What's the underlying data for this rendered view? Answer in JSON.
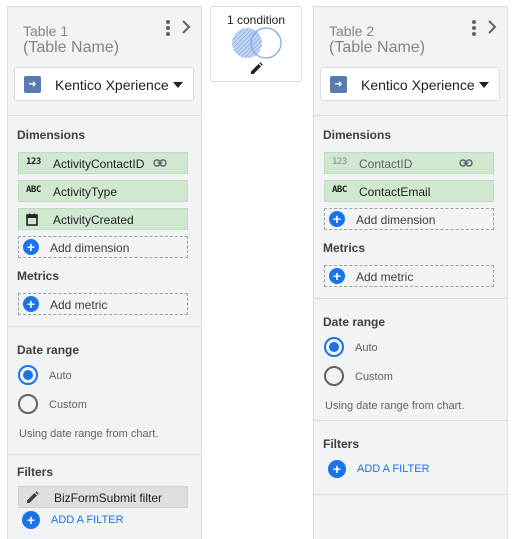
{
  "left_table": {
    "title": "Table 1",
    "subtitle": "(Table Name)",
    "source": "Kentico Xperience",
    "dimensions_label": "Dimensions",
    "dimensions": [
      {
        "type": "123",
        "name": "ActivityContactID",
        "icon": "link-icon"
      },
      {
        "type": "ABC",
        "name": "ActivityType"
      },
      {
        "type": "calendar",
        "name": "ActivityCreated"
      }
    ],
    "add_dimension": "Add dimension",
    "metrics_label": "Metrics",
    "add_metric": "Add metric",
    "date_range_label": "Date range",
    "date_options": [
      "Auto",
      "Custom"
    ],
    "date_selected": "Auto",
    "date_note": "Using date range from chart.",
    "filters_label": "Filters",
    "filter_chip": "BizFormSubmit filter",
    "add_filter": "ADD A FILTER"
  },
  "join": {
    "label": "1 condition"
  },
  "right_table": {
    "title": "Table 2",
    "subtitle": "(Table Name)",
    "source": "Kentico Xperience",
    "dimensions_label": "Dimensions",
    "dimensions": [
      {
        "type": "123",
        "name": "ContactID",
        "icon": "link-icon"
      },
      {
        "type": "ABC",
        "name": "ContactEmail"
      }
    ],
    "add_dimension": "Add dimension",
    "metrics_label": "Metrics",
    "add_metric": "Add metric",
    "date_range_label": "Date range",
    "date_options": [
      "Auto",
      "Custom"
    ],
    "date_selected": "Auto",
    "date_note": "Using date range from chart.",
    "filters_label": "Filters",
    "add_filter": "ADD A FILTER"
  },
  "colors": {
    "accent": "#1a73e8",
    "chip_green": "#cfe8cf",
    "panel_bg": "#f1f3f4"
  }
}
